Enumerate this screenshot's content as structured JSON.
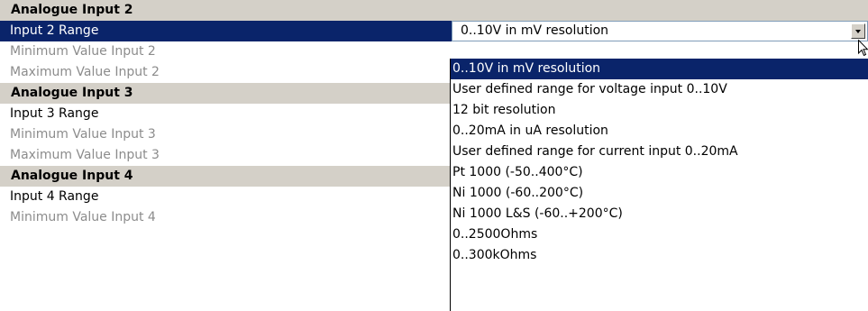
{
  "rows": [
    {
      "type": "header",
      "label": "Analogue Input 2"
    },
    {
      "type": "selected",
      "label": "Input 2 Range",
      "value": "0..10V in mV resolution"
    },
    {
      "type": "disabled",
      "label": "Minimum Value Input 2"
    },
    {
      "type": "disabled",
      "label": "Maximum Value Input 2"
    },
    {
      "type": "header",
      "label": "Analogue Input 3"
    },
    {
      "type": "normal",
      "label": "Input 3 Range"
    },
    {
      "type": "disabled",
      "label": "Minimum Value Input 3"
    },
    {
      "type": "disabled",
      "label": "Maximum Value Input 3"
    },
    {
      "type": "header",
      "label": "Analogue Input 4"
    },
    {
      "type": "normal",
      "label": "Input 4 Range"
    },
    {
      "type": "disabled",
      "label": "Minimum Value Input 4"
    }
  ],
  "dropdown": {
    "options": [
      "0..10V in mV resolution",
      "User defined range for voltage input 0..10V",
      "12 bit resolution",
      "0..20mA in uA resolution",
      "User defined range for current input 0..20mA",
      "Pt 1000 (-50..400°C)",
      "Ni 1000 (-60..200°C)",
      "Ni 1000 L&S (-60..+200°C)",
      "0..2500Ohms",
      "0..300kOhms"
    ],
    "selected_index": 0,
    "icon": "chevron-down-icon"
  },
  "colors": {
    "header_bg": "#d4d0c8",
    "selection_bg": "#0a246a",
    "disabled_text": "#8c8c8c"
  }
}
